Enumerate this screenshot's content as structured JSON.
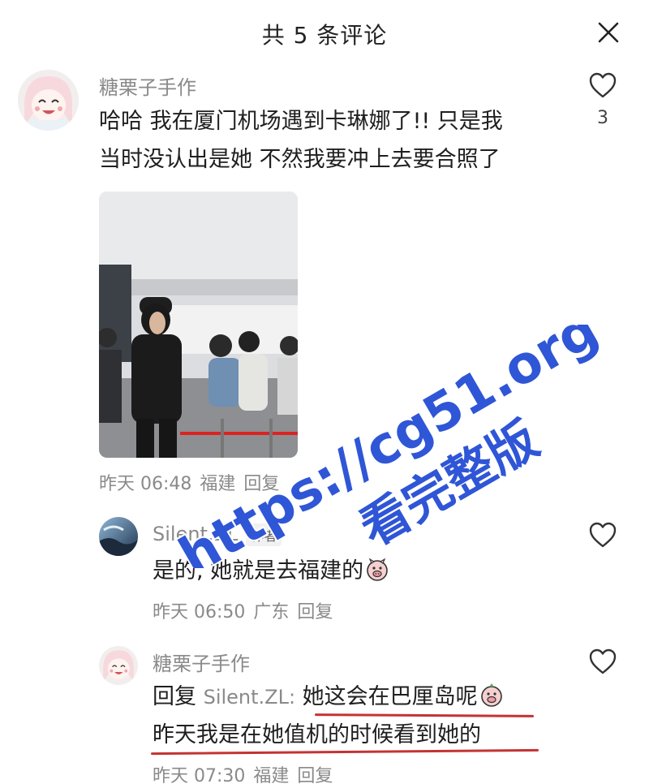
{
  "header": {
    "title": "共 5 条评论"
  },
  "comments": [
    {
      "username": "糖栗子手作",
      "lines": [
        "哈哈 我在厦门机场遇到卡琳娜了!! 只是我",
        "当时没认出是她 不然我要冲上去要合照了"
      ],
      "time": "昨天 06:48",
      "location": "福建",
      "reply": "回复",
      "likes": "3"
    },
    {
      "username": "Silent.ZL",
      "author_tag": "作者",
      "text": "是的, 她就是去福建的",
      "time": "昨天 06:50",
      "location": "广东",
      "reply": "回复"
    },
    {
      "username": "糖栗子手作",
      "reply_prefix": "回复",
      "reply_to": "Silent.ZL:",
      "text_line1": "她这会在巴厘岛呢",
      "text_line2": "昨天我是在她值机的时候看到她的",
      "time": "昨天 07:30",
      "location": "福建",
      "reply": "回复"
    }
  ],
  "watermark": {
    "url": "https://cg51.org",
    "text": "看完整版"
  },
  "icons": {
    "close": "close-icon",
    "like": "heart-icon",
    "emoji": "pig-emoji-icon"
  },
  "colors": {
    "watermark": "#2f56d6",
    "underline": "#c43333",
    "meta": "#8a8a8a"
  }
}
